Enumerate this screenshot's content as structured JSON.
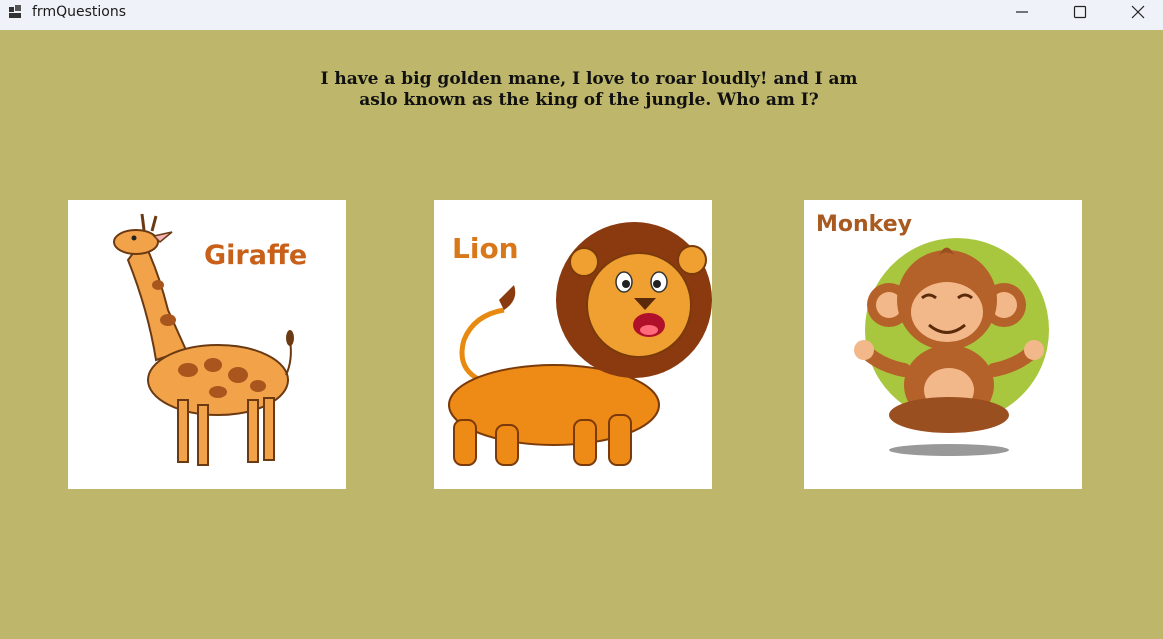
{
  "window": {
    "title": "frmQuestions"
  },
  "question": {
    "text": "I have a big golden mane, I love to roar loudly! and I am aslo known as the king of the jungle. Who am I?"
  },
  "cards": [
    {
      "label": "Giraffe",
      "icon": "giraffe-image"
    },
    {
      "label": "Lion",
      "icon": "lion-image"
    },
    {
      "label": "Monkey",
      "icon": "monkey-image"
    }
  ],
  "colors": {
    "background": "#bdb66b",
    "titlebar": "#eff3f9",
    "card": "#ffffff"
  }
}
